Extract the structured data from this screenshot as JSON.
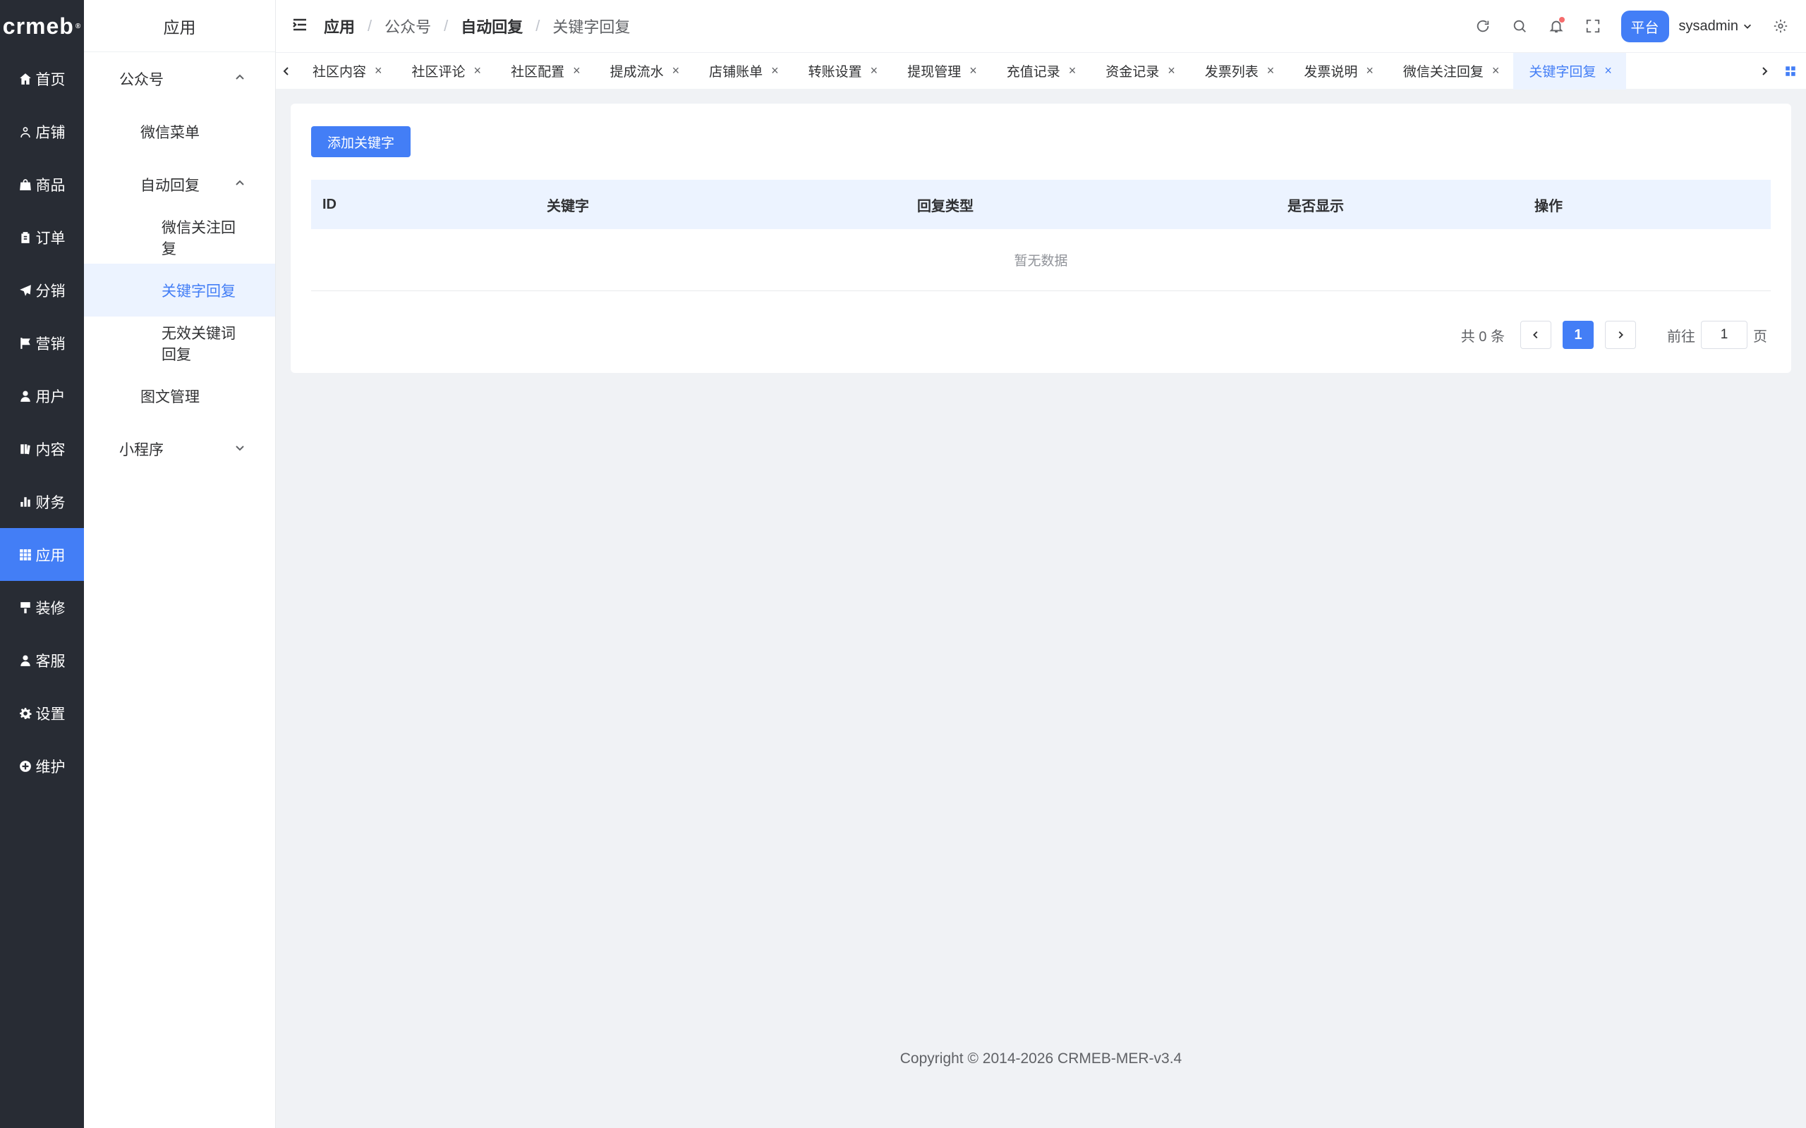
{
  "logo": {
    "text": "crmeb",
    "mark": "®"
  },
  "sidebar": {
    "items": [
      {
        "label": "首页",
        "icon": "home-icon"
      },
      {
        "label": "店铺",
        "icon": "user-outline-icon"
      },
      {
        "label": "商品",
        "icon": "bag-icon"
      },
      {
        "label": "订单",
        "icon": "clipboard-icon"
      },
      {
        "label": "分销",
        "icon": "paper-plane-icon"
      },
      {
        "label": "营销",
        "icon": "flag-icon"
      },
      {
        "label": "用户",
        "icon": "user-icon"
      },
      {
        "label": "内容",
        "icon": "book-icon"
      },
      {
        "label": "财务",
        "icon": "bar-chart-icon"
      },
      {
        "label": "应用",
        "icon": "grid-icon",
        "active": true
      },
      {
        "label": "装修",
        "icon": "paint-brush-icon"
      },
      {
        "label": "客服",
        "icon": "headset-user-icon"
      },
      {
        "label": "设置",
        "icon": "gear-icon"
      },
      {
        "label": "维护",
        "icon": "plus-circle-icon"
      }
    ]
  },
  "submenu": {
    "title": "应用",
    "items": [
      {
        "label": "公众号",
        "level": 1,
        "arrow": "up"
      },
      {
        "label": "微信菜单",
        "level": 2
      },
      {
        "label": "自动回复",
        "level": 2,
        "arrow": "up"
      },
      {
        "label": "微信关注回复",
        "level": 3
      },
      {
        "label": "关键字回复",
        "level": 3,
        "active": true
      },
      {
        "label": "无效关键词回复",
        "level": 3
      },
      {
        "label": "图文管理",
        "level": 2
      },
      {
        "label": "小程序",
        "level": 1,
        "arrow": "down"
      }
    ]
  },
  "header": {
    "breadcrumb": [
      "应用",
      "公众号",
      "自动回复",
      "关键字回复"
    ],
    "platform_label": "平台",
    "username": "sysadmin"
  },
  "tabs": [
    {
      "label": "社区内容"
    },
    {
      "label": "社区评论"
    },
    {
      "label": "社区配置"
    },
    {
      "label": "提成流水"
    },
    {
      "label": "店铺账单"
    },
    {
      "label": "转账设置"
    },
    {
      "label": "提现管理"
    },
    {
      "label": "充值记录"
    },
    {
      "label": "资金记录"
    },
    {
      "label": "发票列表"
    },
    {
      "label": "发票说明"
    },
    {
      "label": "微信关注回复"
    },
    {
      "label": "关键字回复",
      "active": true
    }
  ],
  "main": {
    "add_button": "添加关键字",
    "columns": [
      "ID",
      "关键字",
      "回复类型",
      "是否显示",
      "操作"
    ],
    "empty_text": "暂无数据",
    "pagination": {
      "total_text": "共 0 条",
      "current_page": "1",
      "goto_label": "前往",
      "goto_value": "1",
      "page_suffix": "页"
    }
  },
  "footer": {
    "copyright": "Copyright © 2014-2026 CRMEB-MER-v3.4"
  },
  "colors": {
    "primary": "#437ef6",
    "sidebar_bg": "#282c34",
    "active_bg": "#ecf3ff"
  }
}
